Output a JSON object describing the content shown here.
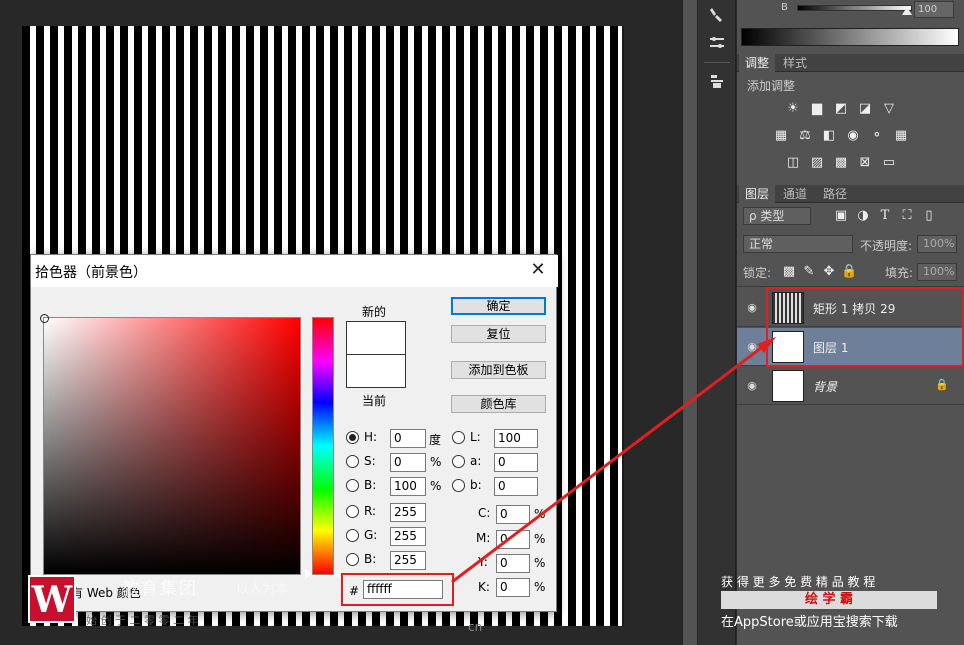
{
  "dialog": {
    "title": "拾色器（前景色）",
    "new_label": "新的",
    "current_label": "当前",
    "buttons": {
      "ok": "确定",
      "reset": "复位",
      "add_swatch": "添加到色板",
      "color_lib": "颜色库"
    },
    "hsb": [
      {
        "label": "H:",
        "value": "0",
        "unit": "度"
      },
      {
        "label": "S:",
        "value": "0",
        "unit": "%"
      },
      {
        "label": "B:",
        "value": "100",
        "unit": "%"
      }
    ],
    "rgb": [
      {
        "label": "R:",
        "value": "255"
      },
      {
        "label": "G:",
        "value": "255"
      },
      {
        "label": "B:",
        "value": "255"
      }
    ],
    "lab": [
      {
        "label": "L:",
        "value": "100"
      },
      {
        "label": "a:",
        "value": "0"
      },
      {
        "label": "b:",
        "value": "0"
      }
    ],
    "cmyk": [
      {
        "label": "C:",
        "value": "0",
        "unit": "%"
      },
      {
        "label": "M:",
        "value": "0",
        "unit": "%"
      },
      {
        "label": "Y:",
        "value": "0",
        "unit": "%"
      },
      {
        "label": "K:",
        "value": "0",
        "unit": "%"
      }
    ],
    "hex_label": "#",
    "hex_value": "ffffff",
    "web_colors_label": "有 Web 颜色",
    "selected_color": "#ffffff"
  },
  "panels": {
    "color_slider": {
      "label": "B",
      "value": "100"
    },
    "adjust_tabs": [
      "调整",
      "样式"
    ],
    "add_adjustment": "添加调整",
    "layer_tabs": [
      "图层",
      "通道",
      "路径"
    ],
    "filter_kind": "ρ 类型",
    "blend_mode": "正常",
    "opacity_label": "不透明度:",
    "opacity_value": "100%",
    "lock_label": "锁定:",
    "fill_label": "填充:",
    "fill_value": "100%",
    "layers": [
      {
        "name": "矩形 1 拷贝 29",
        "selected": false,
        "visible": true
      },
      {
        "name": "图层 1",
        "selected": true,
        "visible": true
      },
      {
        "name": "背景",
        "selected": false,
        "visible": true,
        "locked": true
      }
    ]
  },
  "watermark": {
    "logo_letter": "W",
    "company": "教育集团",
    "slogan": "以人为本",
    "footer": "始 创 于 二 零 零 二 年",
    "cn": "cn",
    "promo_line1": "获 得 更 多 免 费 精 品 教 程",
    "promo_brand": "绘 学 霸",
    "promo_line3": "在AppStore或应用宝搜索下载"
  },
  "colors": {
    "highlight": "#e02020",
    "selected_layer": "#6d7f99",
    "panel_bg": "#535353",
    "app_bg": "#282828",
    "accent_blue": "#0078d7"
  }
}
